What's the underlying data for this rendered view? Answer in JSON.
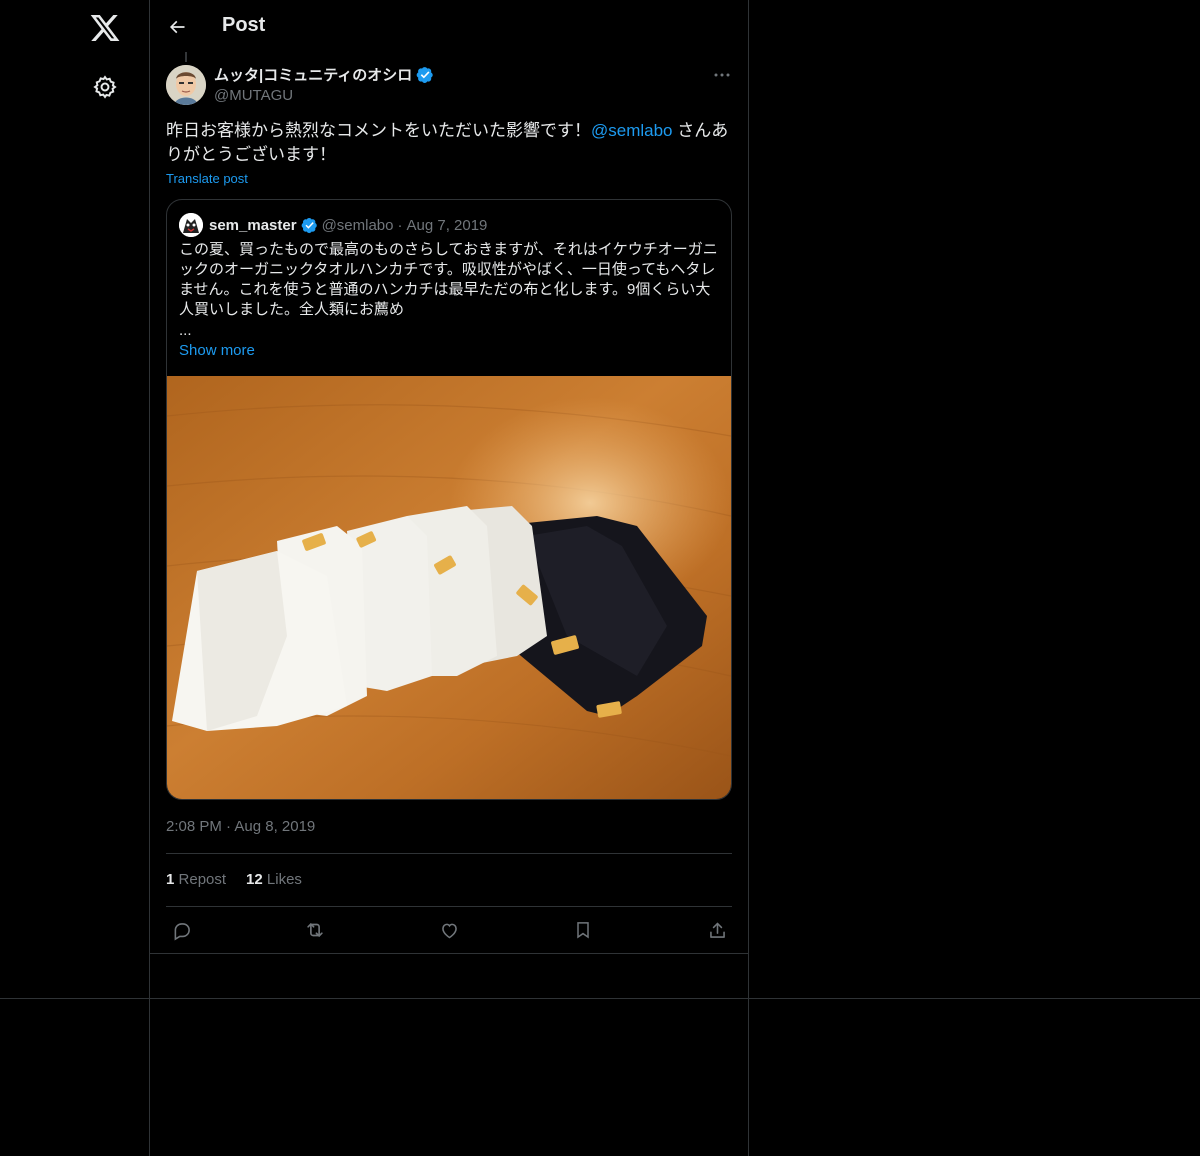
{
  "header": {
    "title": "Post"
  },
  "post": {
    "author_name": "ムッタ|コミュニティのオシロ",
    "author_handle": "@MUTAGU",
    "text_before": "昨日お客様から熱烈なコメントをいただいた影響です！",
    "mention": "@semlabo",
    "text_after": " さんありがとうございます！",
    "translate": "Translate post",
    "timestamp": "2:08 PM · Aug 8, 2019",
    "repost_count": "1",
    "repost_label": "Repost",
    "likes_count": "12",
    "likes_label": "Likes"
  },
  "quote": {
    "name": "sem_master",
    "handle": "@semlabo",
    "date": "Aug 7, 2019",
    "text": "この夏、買ったもので最高のものさらしておきますが、それはイケウチオーガニックのオーガニックタオルハンカチです。吸収性がやばく、一日使ってもヘタレません。これを使うと普通のハンカチは最早ただの布と化します。9個くらい大人買いしました。全人類にお薦め",
    "ellipsis": "...",
    "show_more": "Show more"
  },
  "colors": {
    "background": "#000000",
    "accent": "#1d9bf0",
    "muted": "#71767b",
    "border": "#2f3336",
    "text": "#e7e9ea"
  },
  "icons": {
    "logo": "x-logo-icon",
    "settings": "gear-icon",
    "back": "arrow-left-icon",
    "more": "more-horizontal-icon",
    "verified": "verified-badge-icon",
    "reply": "reply-icon",
    "repost": "repost-icon",
    "like": "heart-icon",
    "bookmark": "bookmark-icon",
    "share": "share-icon"
  }
}
